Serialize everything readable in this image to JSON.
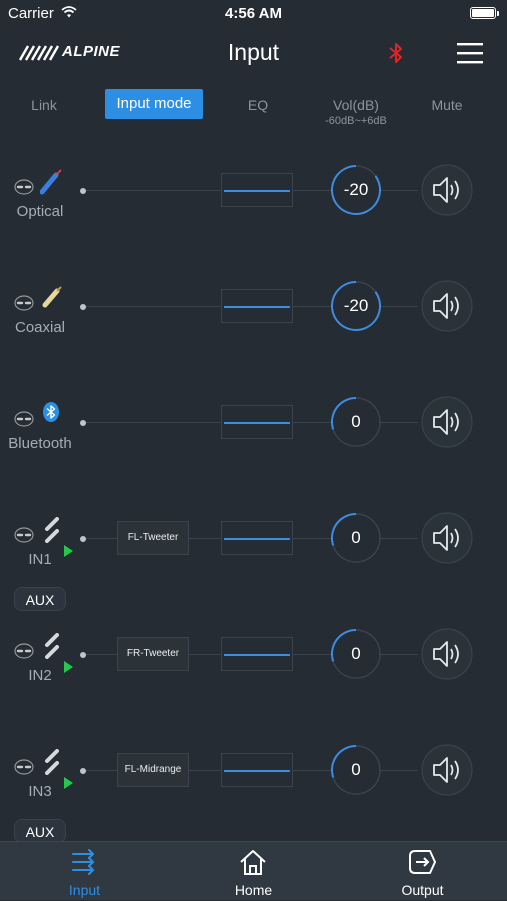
{
  "status_bar": {
    "carrier": "Carrier",
    "time": "4:56 AM"
  },
  "nav": {
    "brand": "ALPINE",
    "title": "Input"
  },
  "columns": {
    "link": "Link",
    "input_mode": "Input mode",
    "eq": "EQ",
    "vol": "Vol(dB)",
    "vol_range": "-60dB~+6dB",
    "mute": "Mute"
  },
  "channels": [
    {
      "name": "Optical",
      "volume": "-20",
      "volume_fraction": 0.85,
      "route": null,
      "source_icon": "optical-cable-icon"
    },
    {
      "name": "Coaxial",
      "volume": "-20",
      "volume_fraction": 0.85,
      "route": null,
      "source_icon": "coaxial-cable-icon"
    },
    {
      "name": "Bluetooth",
      "volume": "0",
      "volume_fraction": 0.3,
      "route": null,
      "source_icon": "bluetooth-icon"
    },
    {
      "name": "IN1",
      "volume": "0",
      "volume_fraction": 0.3,
      "route": "FL-Tweeter",
      "source_icon": "rca-cable-icon"
    },
    {
      "name": "IN2",
      "volume": "0",
      "volume_fraction": 0.3,
      "route": "FR-Tweeter",
      "source_icon": "rca-cable-icon"
    },
    {
      "name": "IN3",
      "volume": "0",
      "volume_fraction": 0.3,
      "route": "FL-Midrange",
      "source_icon": "rca-cable-icon"
    }
  ],
  "aux_tags": [
    "AUX",
    "AUX"
  ],
  "tabs": [
    {
      "label": "Input",
      "icon": "input-sliders-icon",
      "active": true
    },
    {
      "label": "Home",
      "icon": "home-icon",
      "active": false
    },
    {
      "label": "Output",
      "icon": "output-icon",
      "active": false
    }
  ],
  "colors": {
    "accent": "#2d8fe4",
    "background": "#252c33",
    "bluetooth_status": "#e02424",
    "play_green": "#22c94a"
  }
}
